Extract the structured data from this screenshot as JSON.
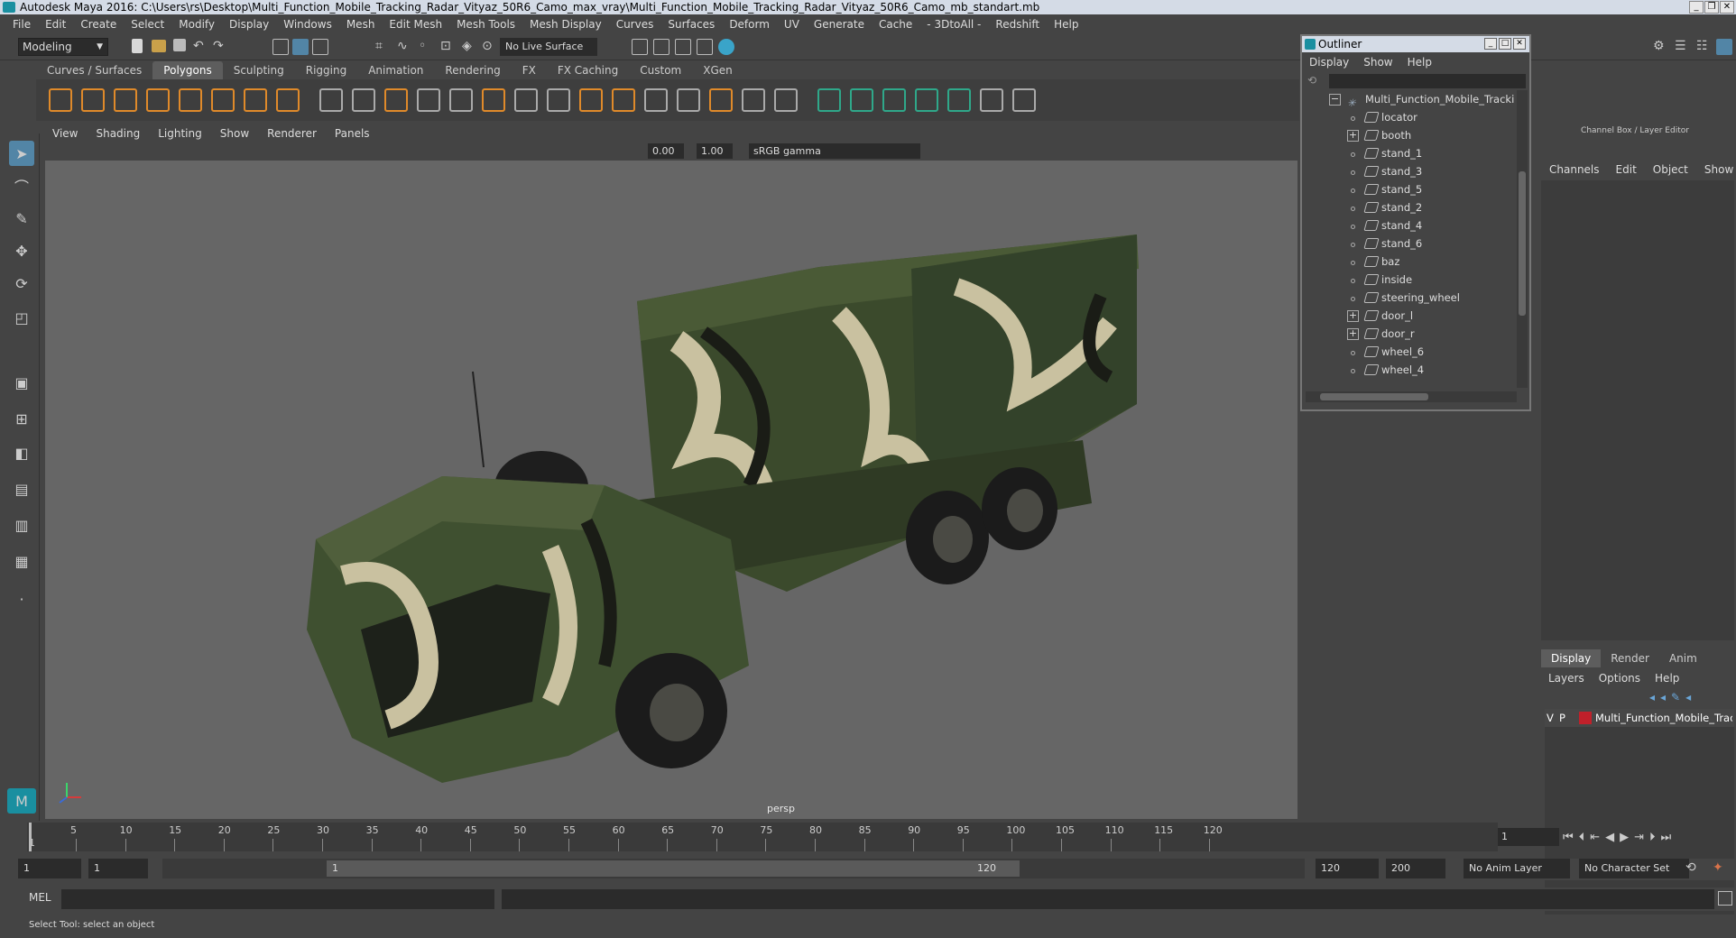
{
  "window": {
    "title": "Autodesk Maya 2016: C:\\Users\\rs\\Desktop\\Multi_Function_Mobile_Tracking_Radar_Vityaz_50R6_Camo_max_vray\\Multi_Function_Mobile_Tracking_Radar_Vityaz_50R6_Camo_mb_standart.mb"
  },
  "menubar": [
    "File",
    "Edit",
    "Create",
    "Select",
    "Modify",
    "Display",
    "Windows",
    "Mesh",
    "Edit Mesh",
    "Mesh Tools",
    "Mesh Display",
    "Curves",
    "Surfaces",
    "Deform",
    "UV",
    "Generate",
    "Cache",
    "- 3DtoAll -",
    "Redshift",
    "Help"
  ],
  "statusline": {
    "mode": "Modeling",
    "live_surface": "No Live Surface"
  },
  "shelf": {
    "tabs": [
      "Curves / Surfaces",
      "Polygons",
      "Sculpting",
      "Rigging",
      "Animation",
      "Rendering",
      "FX",
      "FX Caching",
      "Custom",
      "XGen"
    ],
    "active_tab": "Polygons"
  },
  "viewport": {
    "menu": [
      "View",
      "Shading",
      "Lighting",
      "Show",
      "Renderer",
      "Panels"
    ],
    "exposure": "0.00",
    "gamma": "1.00",
    "color_space": "sRGB gamma",
    "camera_label": "persp"
  },
  "outliner": {
    "title": "Outliner",
    "menu": [
      "Display",
      "Show",
      "Help"
    ],
    "items": [
      {
        "label": "Multi_Function_Mobile_Tracking_",
        "expander": "minus",
        "root": true
      },
      {
        "label": "locator",
        "expander": ""
      },
      {
        "label": "booth",
        "expander": "plus"
      },
      {
        "label": "stand_1",
        "expander": ""
      },
      {
        "label": "stand_3",
        "expander": ""
      },
      {
        "label": "stand_5",
        "expander": ""
      },
      {
        "label": "stand_2",
        "expander": ""
      },
      {
        "label": "stand_4",
        "expander": ""
      },
      {
        "label": "stand_6",
        "expander": ""
      },
      {
        "label": "baz",
        "expander": ""
      },
      {
        "label": "inside",
        "expander": ""
      },
      {
        "label": "steering_wheel",
        "expander": ""
      },
      {
        "label": "door_l",
        "expander": "plus"
      },
      {
        "label": "door_r",
        "expander": "plus"
      },
      {
        "label": "wheel_6",
        "expander": ""
      },
      {
        "label": "wheel_4",
        "expander": ""
      }
    ]
  },
  "channelbox": {
    "title": "Channel Box / Layer Editor",
    "menu": [
      "Channels",
      "Edit",
      "Object",
      "Show"
    ],
    "layer_tabs": [
      "Display",
      "Render",
      "Anim"
    ],
    "active_layer_tab": "Display",
    "layer_menu": [
      "Layers",
      "Options",
      "Help"
    ],
    "layer": {
      "v": "V",
      "p": "P",
      "name": "Multi_Function_Mobile_Track",
      "color": "#c0202a"
    }
  },
  "timeline": {
    "ticks": [
      "5",
      "10",
      "15",
      "20",
      "25",
      "30",
      "35",
      "40",
      "45",
      "50",
      "55",
      "60",
      "65",
      "70",
      "75",
      "80",
      "85",
      "90",
      "95",
      "100",
      "105",
      "110",
      "115",
      "120"
    ],
    "start_marker": "1",
    "current_frame": "1"
  },
  "range": {
    "start": "1",
    "inner_start": "1",
    "handle_start": "1",
    "handle_end": "120",
    "end": "120",
    "max": "200",
    "anim_layer": "No Anim Layer",
    "character_set": "No Character Set"
  },
  "mel": {
    "label": "MEL"
  },
  "helpline": {
    "text": "Select Tool: select an object"
  },
  "colors": {
    "accent": "#5285a6",
    "viewport_bg": "#666666",
    "panel_bg": "#444444"
  }
}
